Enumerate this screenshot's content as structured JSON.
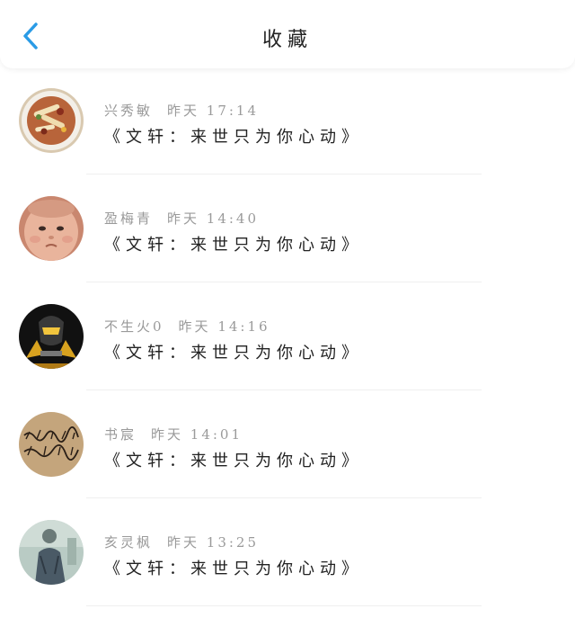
{
  "header": {
    "title": "收藏",
    "back_icon": "chevron-left-icon",
    "accent_color": "#2a9be6"
  },
  "favorites": [
    {
      "author": "兴秀敏",
      "time": "昨天 17:14",
      "content": "《文轩：来世只为你心动》",
      "avatar": "food-dish-avatar"
    },
    {
      "author": "盈梅青",
      "time": "昨天 14:40",
      "content": "《文轩：来世只为你心动》",
      "avatar": "baby-face-avatar"
    },
    {
      "author": "不生火0",
      "time": "昨天 14:16",
      "content": "《文轩：来世只为你心动》",
      "avatar": "robot-helmet-avatar"
    },
    {
      "author": "书宸",
      "time": "昨天 14:01",
      "content": "《文轩：来世只为你心动》",
      "avatar": "handwriting-avatar"
    },
    {
      "author": "亥灵枫",
      "time": "昨天 13:25",
      "content": "《文轩：来世只为你心动》",
      "avatar": "person-photo-avatar"
    }
  ]
}
